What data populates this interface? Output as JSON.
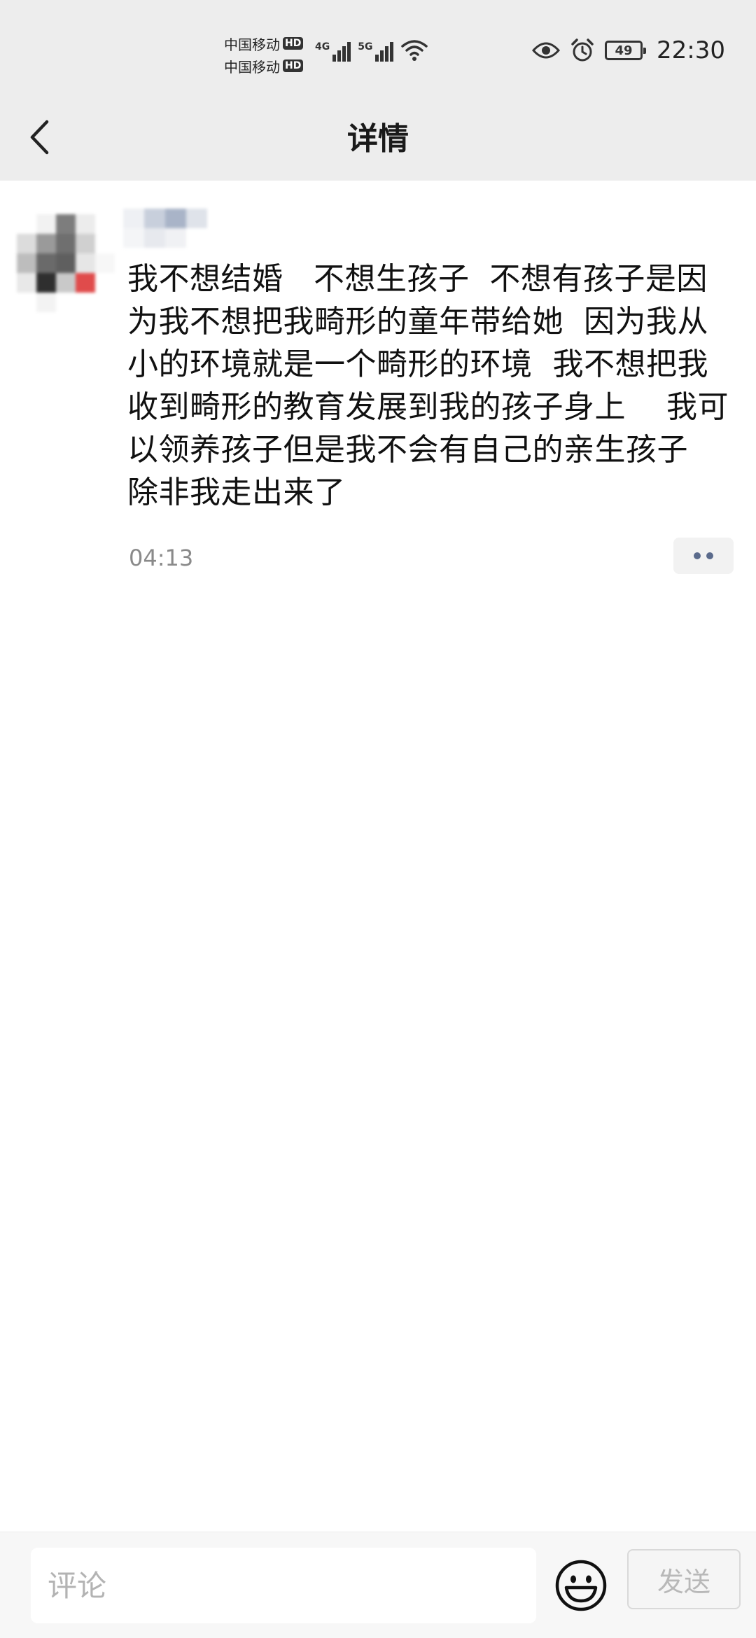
{
  "status_bar": {
    "carriers": [
      {
        "name": "中国移动",
        "badge": "HD"
      },
      {
        "name": "中国移动",
        "badge": "HD"
      }
    ],
    "network_tags": [
      "4G",
      "5G"
    ],
    "battery": "49",
    "time": "22:30",
    "icons": [
      "signal-icon",
      "wifi-icon",
      "eye-icon",
      "alarm-icon",
      "battery-icon"
    ]
  },
  "header": {
    "title": "详情",
    "back_icon": "chevron-left-icon"
  },
  "post": {
    "text": "我不想结婚   不想生孩子  不想有孩子是因为我不想把我畸形的童年带给她  因为我从小的环境就是一个畸形的环境  我不想把我收到畸形的教育发展到我的孩子身上    我可以领养孩子但是我不会有自己的亲生孩子   除非我走出来了",
    "time": "04:13",
    "more_icon": "more-dots-icon"
  },
  "comment_bar": {
    "placeholder": "评论",
    "emoji_icon": "emoji-icon",
    "send_label": "发送"
  },
  "colors": {
    "header_bg": "#ededed",
    "text": "#111111",
    "muted": "#8a8a8a",
    "accent_dots": "#5b6b8c"
  }
}
